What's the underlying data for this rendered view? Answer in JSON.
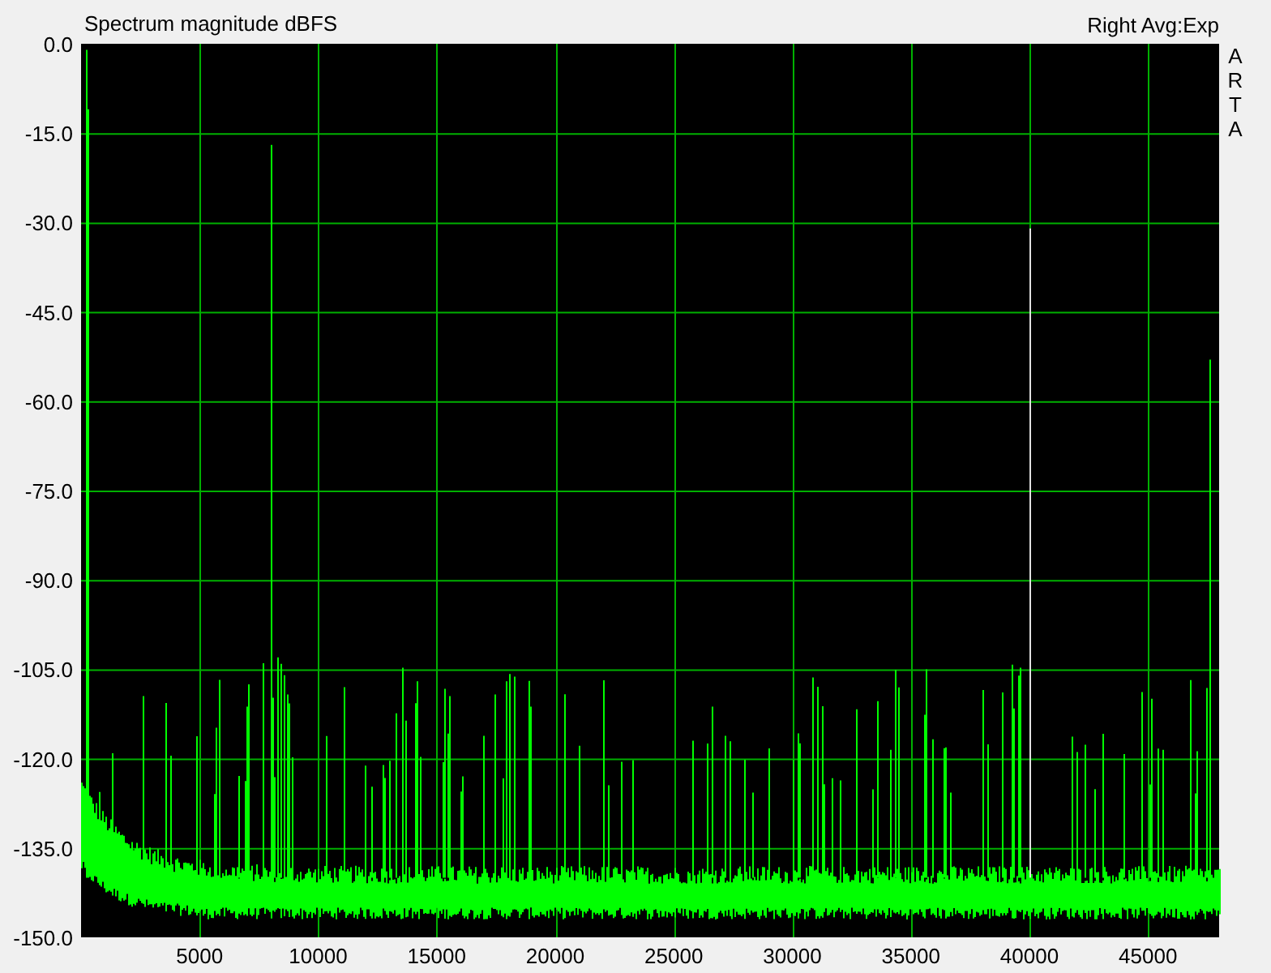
{
  "title": "Spectrum magnitude dBFS",
  "channel_label": "Right Avg:Exp",
  "brand_letters": [
    "A",
    "R",
    "T",
    "A"
  ],
  "y_axis": {
    "labels": [
      "0.0",
      "-15.0",
      "-30.0",
      "-45.0",
      "-60.0",
      "-75.0",
      "-90.0",
      "-105.0",
      "-120.0",
      "-135.0",
      "-150.0"
    ]
  },
  "x_axis": {
    "labels": [
      "5000",
      "10000",
      "15000",
      "20000",
      "25000",
      "30000",
      "35000",
      "40000",
      "45000"
    ]
  }
}
